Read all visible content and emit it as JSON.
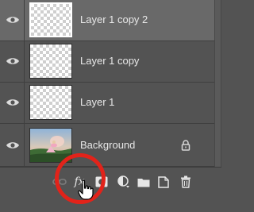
{
  "panel": {
    "name": "Layers panel"
  },
  "layers": [
    {
      "name": "Layer 1 copy 2",
      "selected": true,
      "visible": true,
      "thumbnail": "transparent"
    },
    {
      "name": "Layer 1 copy",
      "selected": false,
      "visible": true,
      "thumbnail": "transparent"
    },
    {
      "name": "Layer 1",
      "selected": false,
      "visible": true,
      "thumbnail": "transparent"
    },
    {
      "name": "Background",
      "selected": false,
      "visible": true,
      "thumbnail": "photo",
      "locked": true
    }
  ],
  "toolbar": {
    "buttons": [
      {
        "icon": "link-icon"
      },
      {
        "icon": "fx-icon",
        "label": "fx",
        "highlighted": true
      },
      {
        "icon": "layer-mask-icon"
      },
      {
        "icon": "adjustment-layer-icon"
      },
      {
        "icon": "folder-icon"
      },
      {
        "icon": "new-layer-icon"
      },
      {
        "icon": "trash-icon"
      }
    ]
  },
  "colors": {
    "highlight_circle": "#e2231a",
    "panel_bg": "#535353",
    "selected_row": "#696969"
  }
}
